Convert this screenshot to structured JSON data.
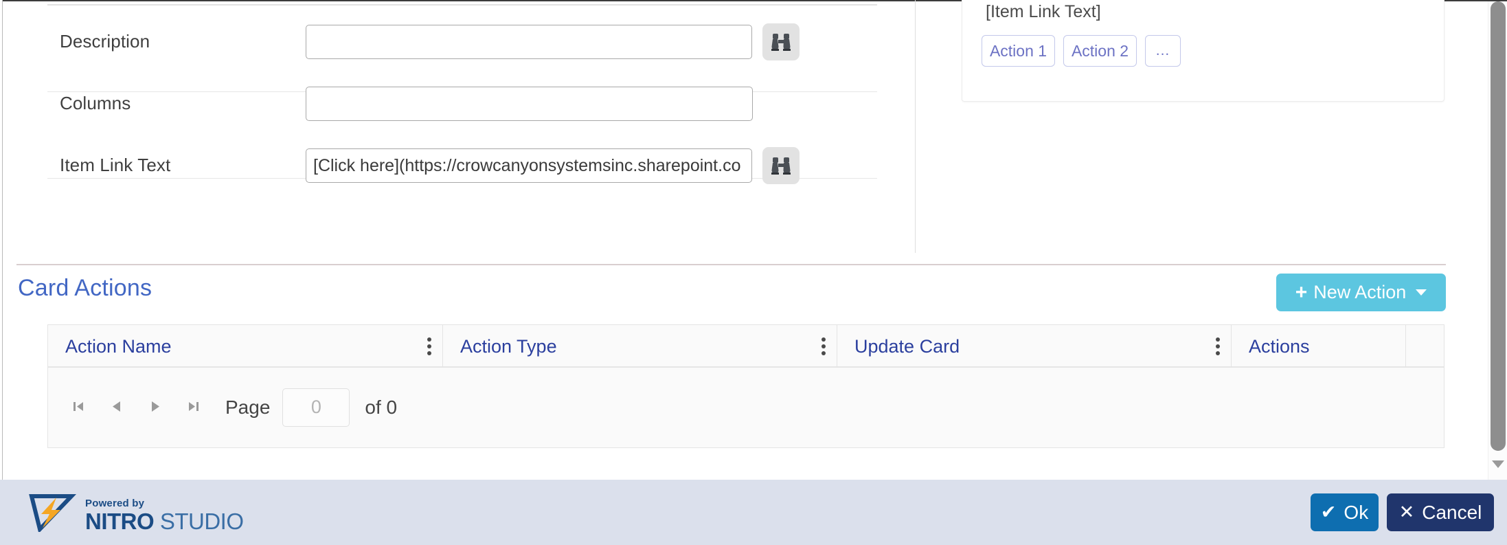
{
  "form": {
    "fields": [
      {
        "label": "Description",
        "value": "",
        "placeholder": "",
        "has_picker": true,
        "picker_icon": "binoculars-icon"
      },
      {
        "label": "Columns",
        "value": "",
        "placeholder": "",
        "has_picker": false,
        "picker_icon": ""
      },
      {
        "label": "Item Link Text",
        "value": "[Click here](https://crowcanyonsystemsinc.sharepoint.co",
        "placeholder": "",
        "has_picker": true,
        "picker_icon": "binoculars-icon"
      }
    ]
  },
  "preview": {
    "link_text": "[Item Link Text]",
    "actions": [
      {
        "label": "Action 1"
      },
      {
        "label": "Action 2"
      },
      {
        "label": "..."
      }
    ]
  },
  "card_actions": {
    "title": "Card Actions",
    "new_action_label": "New Action",
    "new_action_plus": "+",
    "accent_color": "#5cc6e0",
    "columns": [
      {
        "label": "Action Name",
        "menu": true
      },
      {
        "label": "Action Type",
        "menu": true
      },
      {
        "label": "Update Card",
        "menu": true
      },
      {
        "label": "Actions",
        "menu": false
      }
    ],
    "rows": [],
    "pager": {
      "first_icon": "first-page-icon",
      "prev_icon": "previous-page-icon",
      "next_icon": "next-page-icon",
      "last_icon": "last-page-icon",
      "page_label": "Page",
      "page_value": "0",
      "of_label": "of 0"
    }
  },
  "footer": {
    "logo": {
      "powered_by": "Powered by",
      "nitro": "NITRO",
      "studio": " STUDIO"
    },
    "ok_label": "Ok",
    "ok_glyph": "✔",
    "cancel_label": "Cancel",
    "cancel_glyph": "✕",
    "ok_color": "#0e6eb0",
    "cancel_color": "#20356c"
  }
}
